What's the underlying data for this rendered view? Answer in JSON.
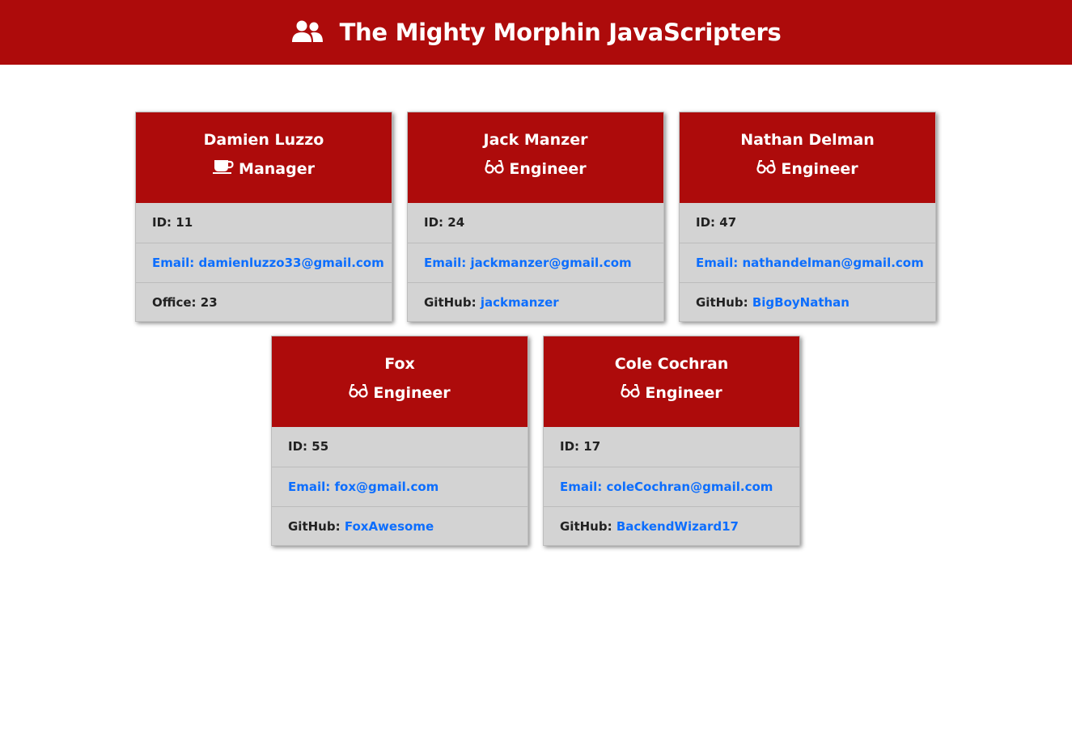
{
  "header": {
    "title": "The Mighty Morphin JavaScripters",
    "icon": "users-icon"
  },
  "colors": {
    "brand_red": "#ad0b0b",
    "card_bg": "#d3d3d3",
    "link_blue": "#0d6efd"
  },
  "cards": [
    {
      "name": "Damien Luzzo",
      "role": "Manager",
      "role_icon": "coffee-mug-icon",
      "id_text": "ID: 11",
      "email_text": "Email: damienluzzo33@gmail.com",
      "extra_label": "Office: 23",
      "extra_value": ""
    },
    {
      "name": "Jack Manzer",
      "role": "Engineer",
      "role_icon": "glasses-icon",
      "id_text": "ID: 24",
      "email_text": "Email: jackmanzer@gmail.com",
      "extra_label": "GitHub: ",
      "extra_value": "jackmanzer"
    },
    {
      "name": "Nathan Delman",
      "role": "Engineer",
      "role_icon": "glasses-icon",
      "id_text": "ID: 47",
      "email_text": "Email: nathandelman@gmail.com",
      "extra_label": "GitHub: ",
      "extra_value": "BigBoyNathan"
    },
    {
      "name": "Fox",
      "role": "Engineer",
      "role_icon": "glasses-icon",
      "id_text": "ID: 55",
      "email_text": "Email: fox@gmail.com",
      "extra_label": "GitHub: ",
      "extra_value": "FoxAwesome"
    },
    {
      "name": "Cole Cochran",
      "role": "Engineer",
      "role_icon": "glasses-icon",
      "id_text": "ID: 17",
      "email_text": "Email: coleCochran@gmail.com",
      "extra_label": "GitHub: ",
      "extra_value": "BackendWizard17"
    }
  ]
}
